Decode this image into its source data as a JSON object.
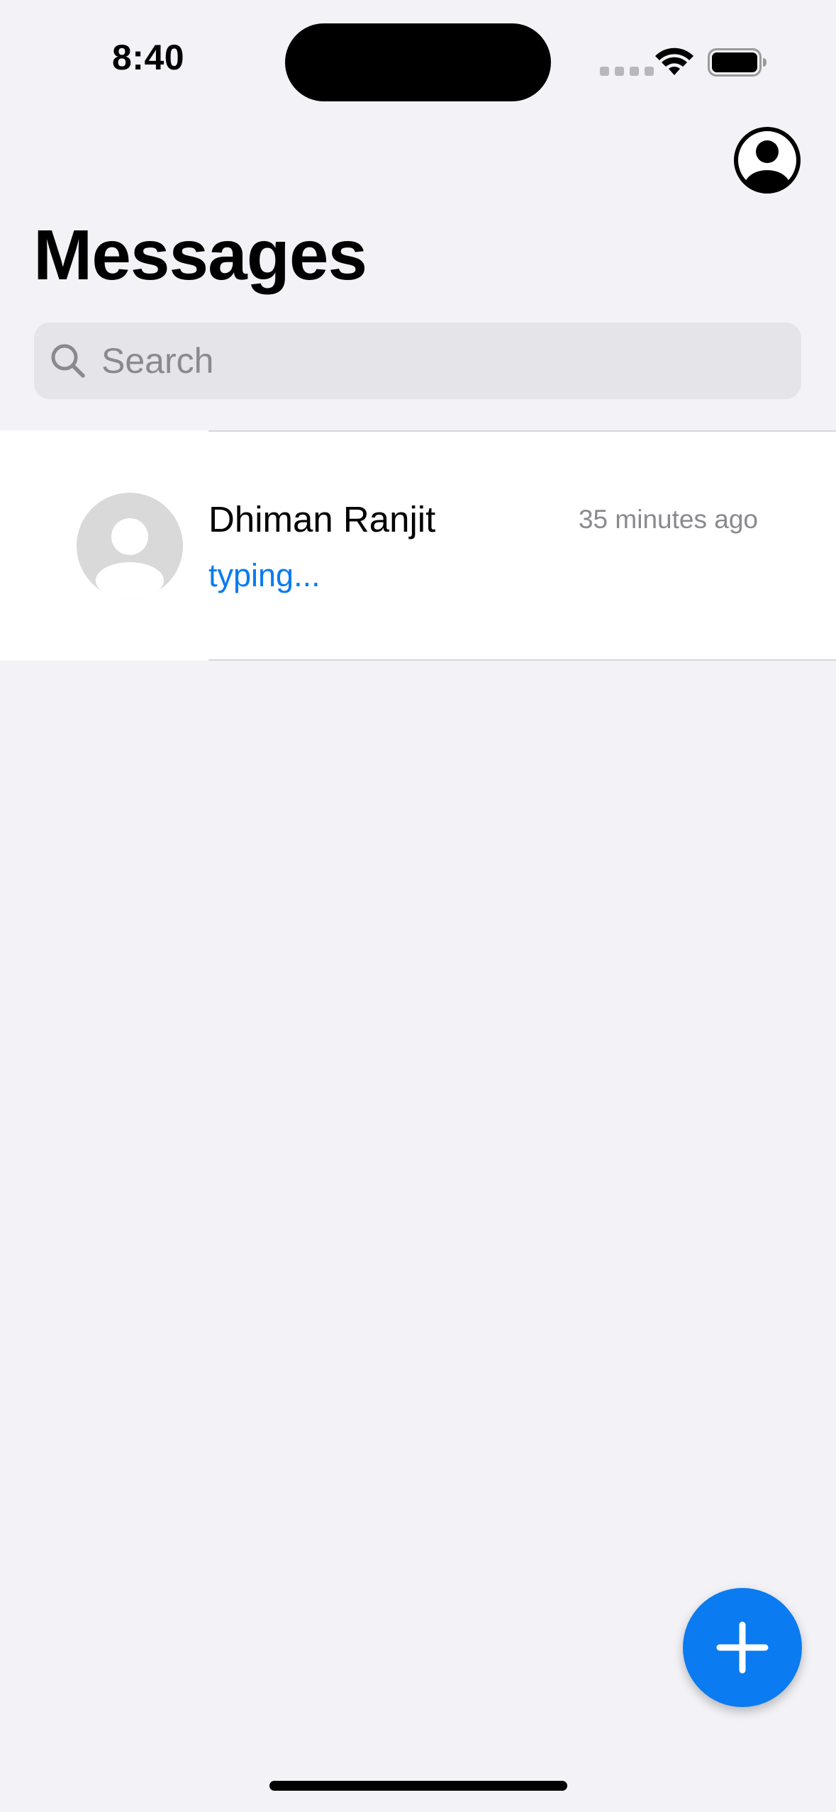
{
  "status_bar": {
    "time": "8:40"
  },
  "header": {
    "title": "Messages",
    "profile_icon": "person-circle-icon"
  },
  "search": {
    "placeholder": "Search",
    "value": "",
    "icon": "search-icon"
  },
  "conversations": [
    {
      "name": "Dhiman Ranjit",
      "timestamp": "35 minutes ago",
      "preview": "typing...",
      "avatar_icon": "person-placeholder-icon"
    }
  ],
  "fab": {
    "icon": "plus-icon"
  },
  "colors": {
    "accent": "#0a7bf0",
    "background": "#f2f2f7",
    "search_bg": "#e4e4e9",
    "secondary_text": "#8a8a8e"
  }
}
